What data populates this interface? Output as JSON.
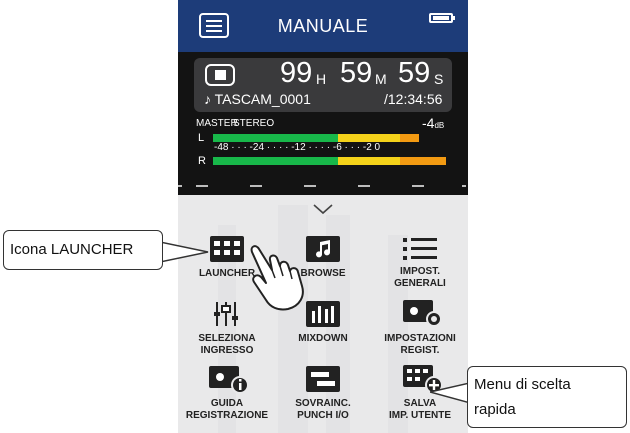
{
  "header": {
    "title": "MANUALE"
  },
  "recorder": {
    "hours": "99",
    "hours_unit": "H",
    "minutes": "59",
    "minutes_unit": "M",
    "seconds": "59",
    "seconds_unit": "S",
    "filename": "♪ TASCAM_0001",
    "remaining": "/12:34:56",
    "master_label": "MASTER",
    "mode_label": "STEREO",
    "level_value": "-4",
    "level_unit": "dB",
    "left_label": "L",
    "right_label": "R",
    "scale": "-48 · · · -24 · · · · -12 · · · · -6 · · · -2 0",
    "left_level_fraction": 0.86,
    "right_level_fraction": 0.97
  },
  "launcher": {
    "items": [
      {
        "label_line1": "LAUNCHER",
        "label_line2": "",
        "icon": "grid-icon"
      },
      {
        "label_line1": "BROWSE",
        "label_line2": "",
        "icon": "music-note-icon"
      },
      {
        "label_line1": "IMPOST.",
        "label_line2": "GENERALI",
        "icon": "list-icon"
      },
      {
        "label_line1": "SELEZIONA",
        "label_line2": "INGRESSO",
        "icon": "input-select-icon"
      },
      {
        "label_line1": "MIXDOWN",
        "label_line2": "",
        "icon": "mixdown-icon"
      },
      {
        "label_line1": "IMPOSTAZIONI",
        "label_line2": "REGIST.",
        "icon": "rec-settings-icon"
      },
      {
        "label_line1": "GUIDA",
        "label_line2": "REGISTRAZIONE",
        "icon": "rec-guide-icon"
      },
      {
        "label_line1": "SOVRAINC.",
        "label_line2": "PUNCH I/O",
        "icon": "punch-io-icon"
      },
      {
        "label_line1": "SALVA",
        "label_line2": "IMP. UTENTE",
        "icon": "save-user-icon"
      }
    ]
  },
  "callouts": {
    "launcher_icon": "Icona LAUNCHER",
    "shortcut_menu_line1": "Menu di scelta",
    "shortcut_menu_line2": "rapida"
  },
  "colors": {
    "header": "#1d3c79",
    "meter_green": "#18b84a",
    "meter_yellow": "#f4d21a",
    "meter_orange": "#f29a12"
  }
}
